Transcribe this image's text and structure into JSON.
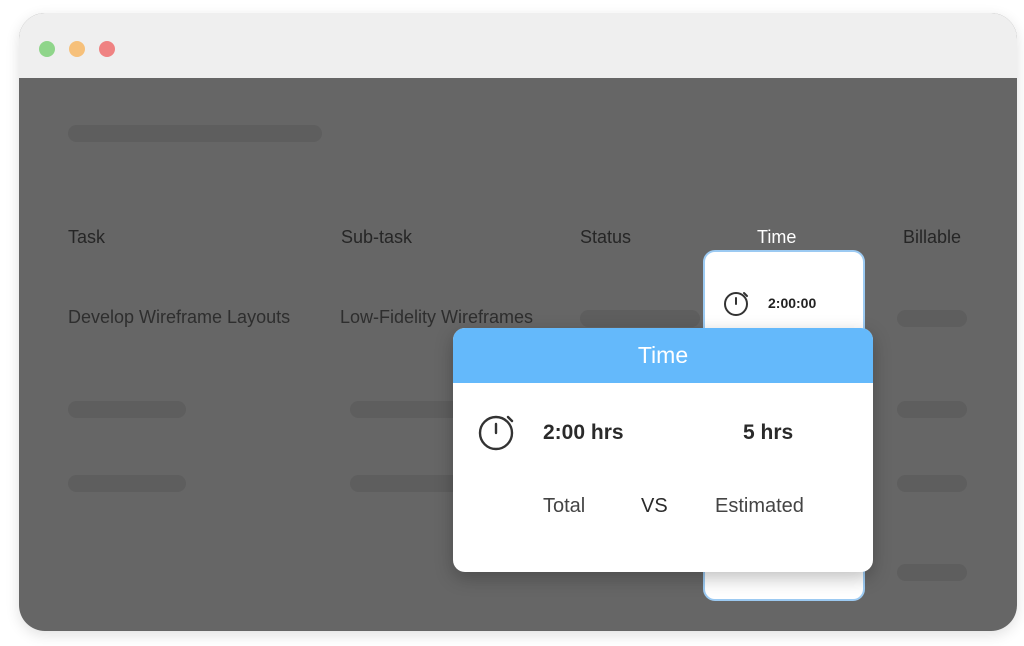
{
  "window": {
    "controls": [
      "green-dot",
      "yellow-dot",
      "red-dot"
    ]
  },
  "table": {
    "headers": {
      "task": "Task",
      "subtask": "Sub-task",
      "status": "Status",
      "time": "Time",
      "billable": "Billable"
    },
    "row1": {
      "task": "Develop Wireframe Layouts",
      "subtask": "Low-Fidelity Wireframes",
      "time": "2:00:00"
    }
  },
  "popup": {
    "title": "Time",
    "total_value": "2:00 hrs",
    "estimated_value": "5 hrs",
    "total_label": "Total",
    "vs_label": "VS",
    "estimated_label": "Estimated"
  },
  "icons": {
    "timer": "stopwatch-icon"
  },
  "colors": {
    "accent": "#64b9fb",
    "overlay": "#666666",
    "titlebar": "#efefef"
  }
}
